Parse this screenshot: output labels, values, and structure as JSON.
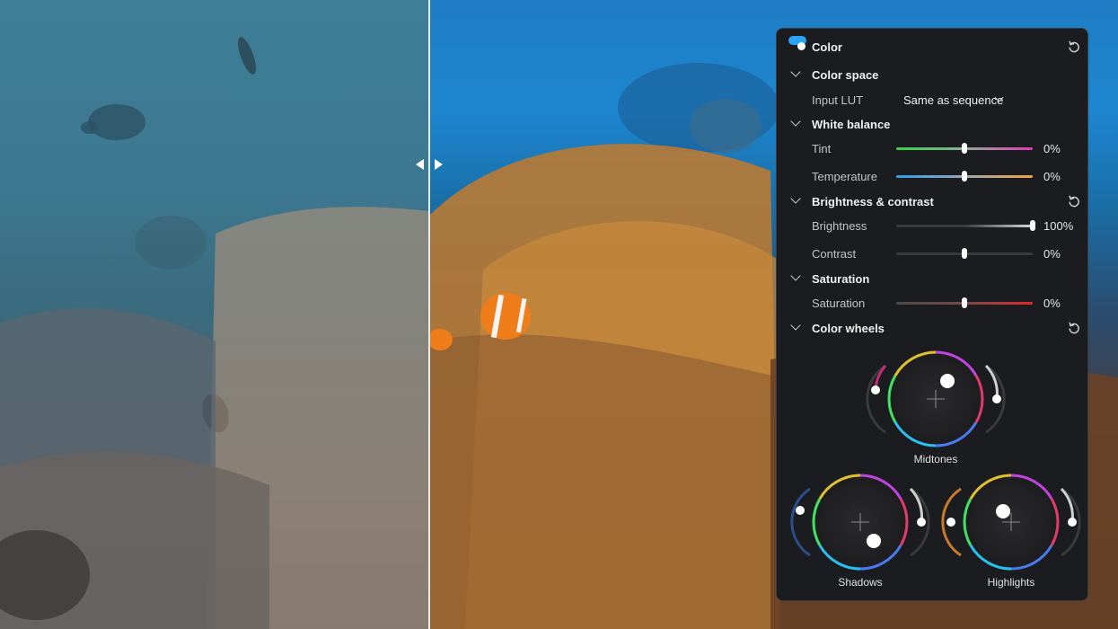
{
  "panel": {
    "title": "Color",
    "enabled": true,
    "color_space": {
      "header": "Color space",
      "input_lut_label": "Input LUT",
      "input_lut_value": "Same as sequence"
    },
    "white_balance": {
      "header": "White balance",
      "tint_label": "Tint",
      "tint_value": "0%",
      "tint_level": 0.5,
      "temperature_label": "Temperature",
      "temperature_value": "0%",
      "temperature_level": 0.5
    },
    "brightness_contrast": {
      "header": "Brightness & contrast",
      "brightness_label": "Brightness",
      "brightness_value": "100%",
      "brightness_level": 1.0,
      "contrast_label": "Contrast",
      "contrast_value": "0%",
      "contrast_level": 0.5
    },
    "saturation": {
      "header": "Saturation",
      "saturation_label": "Saturation",
      "saturation_value": "0%",
      "saturation_level": 0.5
    },
    "color_wheels": {
      "header": "Color wheels",
      "midtones_label": "Midtones",
      "shadows_label": "Shadows",
      "highlights_label": "Highlights"
    }
  },
  "colors": {
    "accent": "#2aa4f4",
    "panel_bg": "#1b1c1f",
    "tint_gradient": [
      "#33d24a",
      "#e23ab5"
    ],
    "temperature_gradient": [
      "#2f9cf0",
      "#f0a33a"
    ],
    "saturation_gradient": [
      "#555555",
      "#e02a2a"
    ]
  }
}
